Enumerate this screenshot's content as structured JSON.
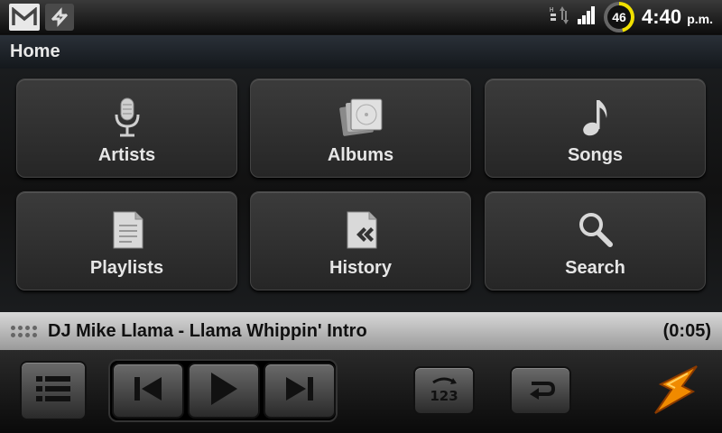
{
  "status_bar": {
    "battery_level": "46",
    "time": "4:40",
    "ampm": "p.m.",
    "icons": [
      "gmail-icon",
      "sync-icon",
      "data-transfer-icon",
      "signal-icon"
    ]
  },
  "title": "Home",
  "tiles": [
    {
      "label": "Artists",
      "icon": "microphone-icon"
    },
    {
      "label": "Albums",
      "icon": "album-icon"
    },
    {
      "label": "Songs",
      "icon": "music-note-icon"
    },
    {
      "label": "Playlists",
      "icon": "playlist-icon"
    },
    {
      "label": "History",
      "icon": "history-icon"
    },
    {
      "label": "Search",
      "icon": "search-icon"
    }
  ],
  "now_playing": {
    "title": "DJ Mike Llama - Llama Whippin' Intro",
    "time": "(0:05)"
  },
  "controls": {
    "buttons": [
      "menu-list-icon",
      "previous-icon",
      "play-icon",
      "next-icon",
      "shuffle-icon",
      "repeat-icon",
      "winamp-logo"
    ],
    "shuffle_text": "123"
  },
  "colors": {
    "battery": "#f0e000",
    "logo": "#f08a00"
  }
}
